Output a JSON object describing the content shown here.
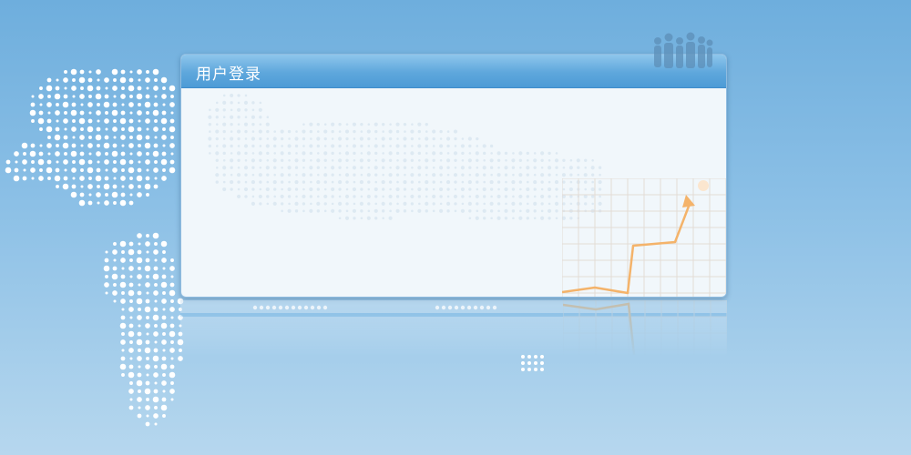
{
  "login_panel": {
    "title": "用户登录"
  },
  "icons": {
    "people": "people-silhouette-icon",
    "chart": "growth-chart-icon"
  },
  "colors": {
    "header": "#5ea7dc",
    "panel_background": "#f1f7fb",
    "chart_line": "#f4b36a",
    "page_background": "#8cc0e6"
  }
}
